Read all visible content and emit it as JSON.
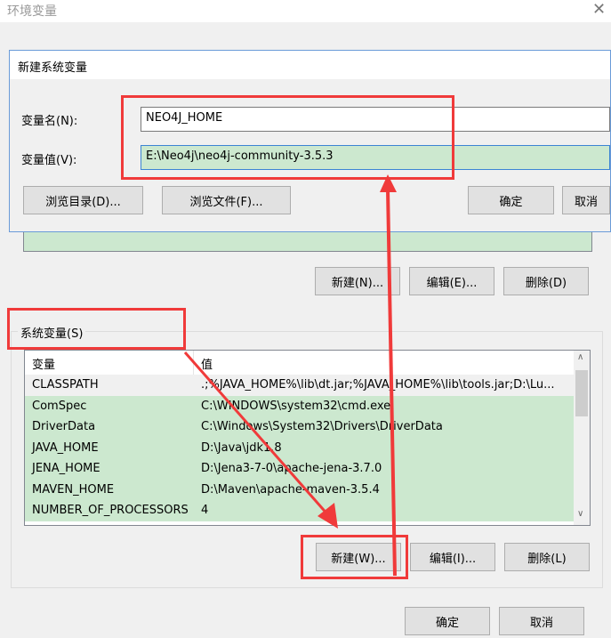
{
  "window": {
    "title": "环境变量"
  },
  "user_vars": {
    "buttons": [
      "新建(N)...",
      "编辑(E)...",
      "删除(D)"
    ]
  },
  "system_vars": {
    "group_label": "系统变量(S)",
    "columns": [
      "变量",
      "值"
    ],
    "rows": [
      [
        "CLASSPATH",
        ".;%JAVA_HOME%\\lib\\dt.jar;%JAVA_HOME%\\lib\\tools.jar;D:\\Lu..."
      ],
      [
        "ComSpec",
        "C:\\WINDOWS\\system32\\cmd.exe"
      ],
      [
        "DriverData",
        "C:\\Windows\\System32\\Drivers\\DriverData"
      ],
      [
        "JAVA_HOME",
        "D:\\Java\\jdk1.8"
      ],
      [
        "JENA_HOME",
        "D:\\Jena3-7-0\\apache-jena-3.7.0"
      ],
      [
        "MAVEN_HOME",
        "D:\\Maven\\apache-maven-3.5.4"
      ],
      [
        "NUMBER_OF_PROCESSORS",
        "4"
      ]
    ],
    "buttons": [
      "新建(W)...",
      "编辑(I)...",
      "删除(L)"
    ]
  },
  "footer": {
    "ok": "确定",
    "cancel": "取消"
  },
  "dialog": {
    "title": "新建系统变量",
    "name_label": "变量名(N):",
    "name_value": "NEO4J_HOME",
    "value_label": "变量值(V):",
    "value_value": "E:\\Neo4j\\neo4j-community-3.5.3",
    "browse_dir": "浏览目录(D)...",
    "browse_file": "浏览文件(F)...",
    "ok": "确定",
    "cancel": "取消"
  },
  "colors": {
    "selection": "#cce8cf",
    "annotation": "#f03a3a"
  }
}
